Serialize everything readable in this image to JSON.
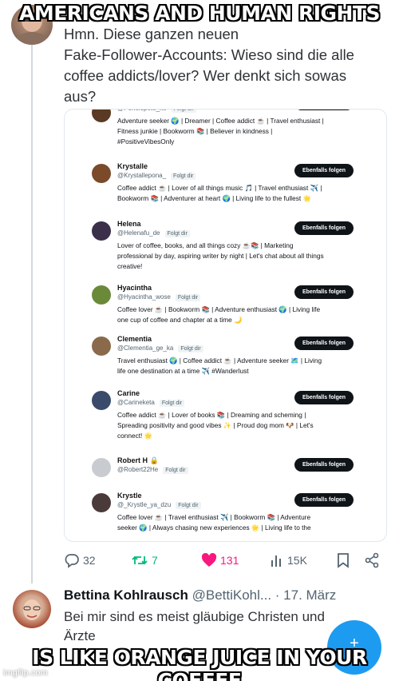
{
  "meme": {
    "top_text": "AMERICANS AND HUMAN RIGHTS",
    "bottom_text": "IS LIKE ORANGE JUICE IN YOUR COFFEE",
    "watermark": "imgflip.com"
  },
  "tweet": {
    "text_line1": "Hmn. Diese ganzen neuen",
    "text_line2": "Fake-Follower-Accounts: Wieso sind die alle",
    "text_line3": "coffee addicts/lover? Wer denkt sich sowas",
    "text_line4": "aus?"
  },
  "embed": {
    "follows_you_label": "Folgt dir",
    "follow_back_label": "Ebenfalls folgen",
    "accounts": [
      {
        "name": "",
        "handle": "@Penelopete_ke",
        "bio_lines": [
          "Adventure seeker 🌍 | Dreamer | Coffee addict ☕ | Travel enthusiast |",
          "Fitness junkie | Bookworm 📚 | Believer in kindness |",
          "#PositiveVibesOnly"
        ]
      },
      {
        "name": "Krystalle",
        "handle": "@Krystallepona_",
        "bio_lines": [
          "Coffee addict ☕ | Lover of all things music 🎵 | Travel enthusiast ✈️ |",
          "Bookworm 📚 | Adventurer at heart 🌍 | Living life to the fullest 🌟"
        ]
      },
      {
        "name": "Helena",
        "handle": "@Helenafu_de",
        "bio_lines": [
          "Lover of coffee, books, and all things cozy ☕📚 | Marketing",
          "professional by day, aspiring writer by night | Let's chat about all things",
          "creative!"
        ]
      },
      {
        "name": "Hyacintha",
        "handle": "@Hyacintha_wose",
        "bio_lines": [
          "Coffee lover ☕ | Bookworm 📚 | Adventure enthusiast 🌍 | Living life",
          "one cup of coffee and chapter at a time 🌙"
        ]
      },
      {
        "name": "Clementia",
        "handle": "@Clementia_ge_ka",
        "bio_lines": [
          "Travel enthusiast 🌍 | Coffee addict ☕ | Adventure seeker 🗺️ | Living",
          "life one destination at a time ✈️ #Wanderlust"
        ]
      },
      {
        "name": "Carine",
        "handle": "@Carineketa",
        "bio_lines": [
          "Coffee addict ☕ | Lover of books 📚 | Dreaming and scheming |",
          "Spreading positivity and good vibes ✨ | Proud dog mom 🐶 | Let's",
          "connect! 🌟"
        ]
      },
      {
        "name": "Robert H 🔒",
        "handle": "@Robert22He",
        "bio_lines": []
      },
      {
        "name": "Krystle",
        "handle": "@_Krystle_ya_dzu",
        "bio_lines": [
          "Coffee lover ☕ | Travel enthusiast ✈️ | Bookworm 📚 | Adventure",
          "seeker 🌍 | Always chasing new experiences 🌟 | Living life to the"
        ]
      }
    ]
  },
  "actions": {
    "replies": "32",
    "retweets": "7",
    "likes": "131",
    "views": "15K"
  },
  "reply": {
    "name": "Bettina Kohlrausch",
    "handle": "@BettiKohl...",
    "date": " · 17. März",
    "text_line1": "Bei mir sind es meist gläubige Christen und",
    "text_line2": "Ärzte"
  },
  "colors": {
    "accent_blue": "#1d9bf0",
    "retweet_green": "#00ba7c",
    "like_pink": "#f91880"
  }
}
